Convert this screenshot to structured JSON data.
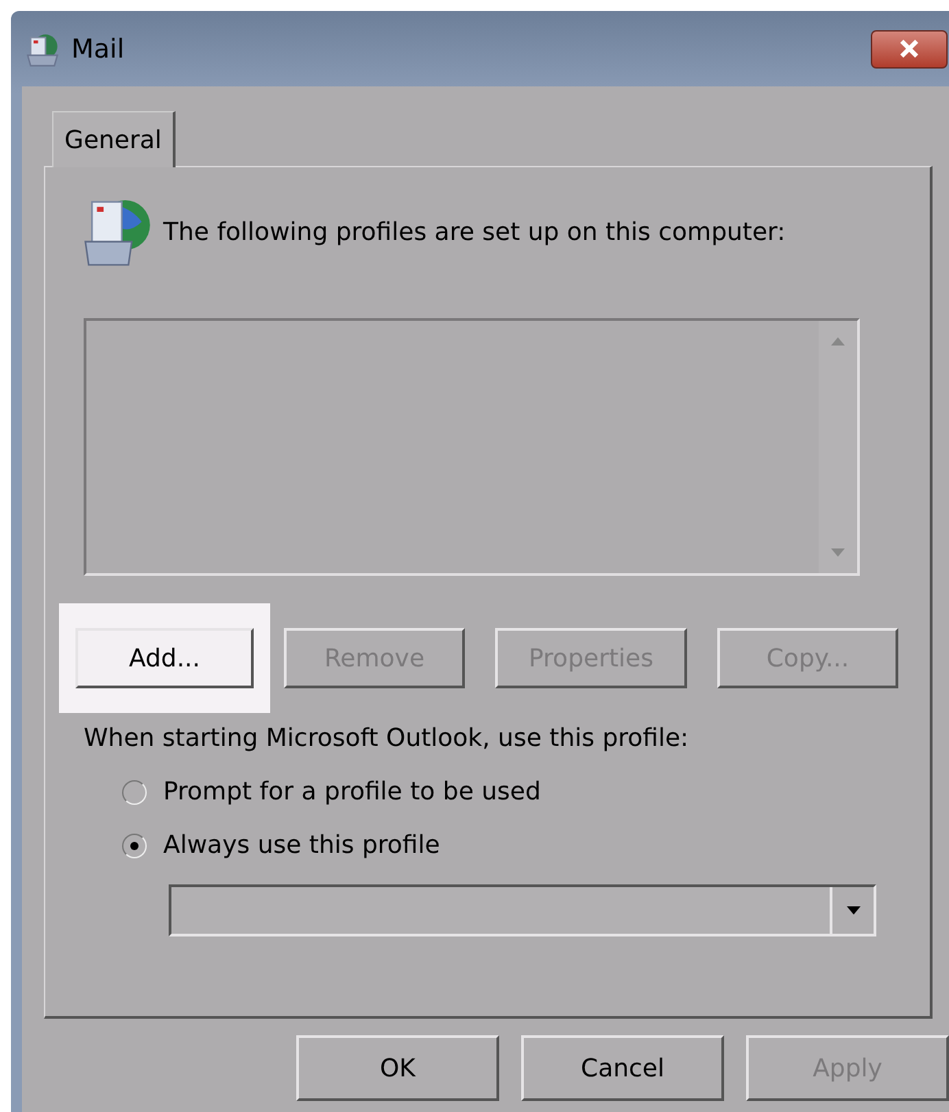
{
  "window": {
    "title": "Mail"
  },
  "tabs": [
    {
      "label": "General",
      "selected": true
    }
  ],
  "intro": "The following profiles are set up on this computer:",
  "profile_buttons": [
    {
      "label": "Add...",
      "disabled": false,
      "highlighted": true
    },
    {
      "label": "Remove",
      "disabled": true,
      "highlighted": false
    },
    {
      "label": "Properties",
      "disabled": true,
      "highlighted": false
    },
    {
      "label": "Copy...",
      "disabled": true,
      "highlighted": false
    }
  ],
  "startup_label": "When starting Microsoft Outlook, use this profile:",
  "startup_options": [
    {
      "label": "Prompt for a profile to be used",
      "selected": false
    },
    {
      "label": "Always use this profile",
      "selected": true
    }
  ],
  "profile_dropdown": {
    "disabled": true
  },
  "dialog_buttons": [
    {
      "label": "OK",
      "disabled": false
    },
    {
      "label": "Cancel",
      "disabled": false
    },
    {
      "label": "Apply",
      "disabled": true
    }
  ]
}
